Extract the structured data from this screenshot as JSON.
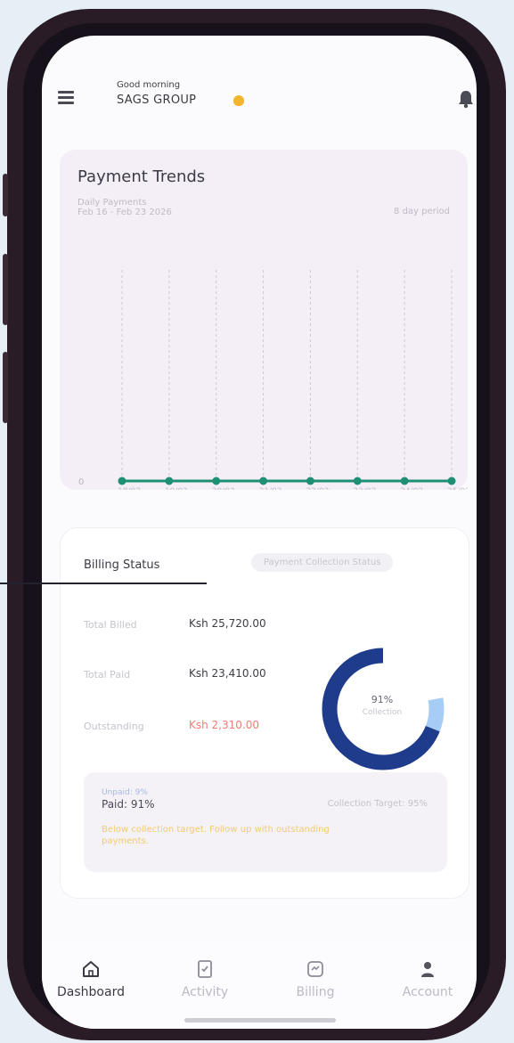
{
  "header": {
    "greeting": "Good morning",
    "company": "SAGS GROUP",
    "menu_icon": "hamburger-menu-icon",
    "notification_icon": "bell-icon"
  },
  "payment_trends": {
    "title": "Payment Trends",
    "subtitle": "Daily Payments",
    "date_range": "Feb 16 - Feb 23 2026",
    "period": "8 day period",
    "chart_data": {
      "type": "line",
      "categories": [
        "18/02",
        "19/02",
        "20/02",
        "21/02",
        "22/02",
        "23/02",
        "24/02",
        "25/02"
      ],
      "series": [
        {
          "values": [
            0,
            0,
            0,
            0,
            0,
            0,
            0,
            0
          ]
        }
      ],
      "y_ticks": [
        "0"
      ],
      "ylim": [
        0,
        1
      ],
      "grid": "vertical dashed",
      "line_color": "#1f8f73"
    }
  },
  "billing": {
    "tab_active": "Billing Status",
    "tab_inactive": "Payment Collection Status",
    "stats": [
      {
        "label": "Total Billed",
        "value": "Ksh 25,720.00"
      },
      {
        "label": "Total Paid",
        "value": "Ksh 23,410.00"
      },
      {
        "label": "Outstanding",
        "value": "Ksh 2,310.00"
      }
    ],
    "donut": {
      "percent_label": "91%",
      "caption": "Collection",
      "collected_fraction": 0.91,
      "colors": {
        "collected": "#1f3b8c",
        "outstanding": "#a6cdf5"
      }
    },
    "alert": {
      "unpaid": "Unpaid: 9%",
      "paid": "Paid: 91%",
      "target": "Collection Target: 95%",
      "warning": "Below collection target. Follow up with outstanding payments."
    }
  },
  "nav": [
    {
      "label": "Dashboard",
      "icon": "home-icon",
      "active": true
    },
    {
      "label": "Activity",
      "icon": "activity-icon",
      "active": false
    },
    {
      "label": "Billing",
      "icon": "billing-icon",
      "active": false
    },
    {
      "label": "Account",
      "icon": "account-icon",
      "active": false
    }
  ]
}
